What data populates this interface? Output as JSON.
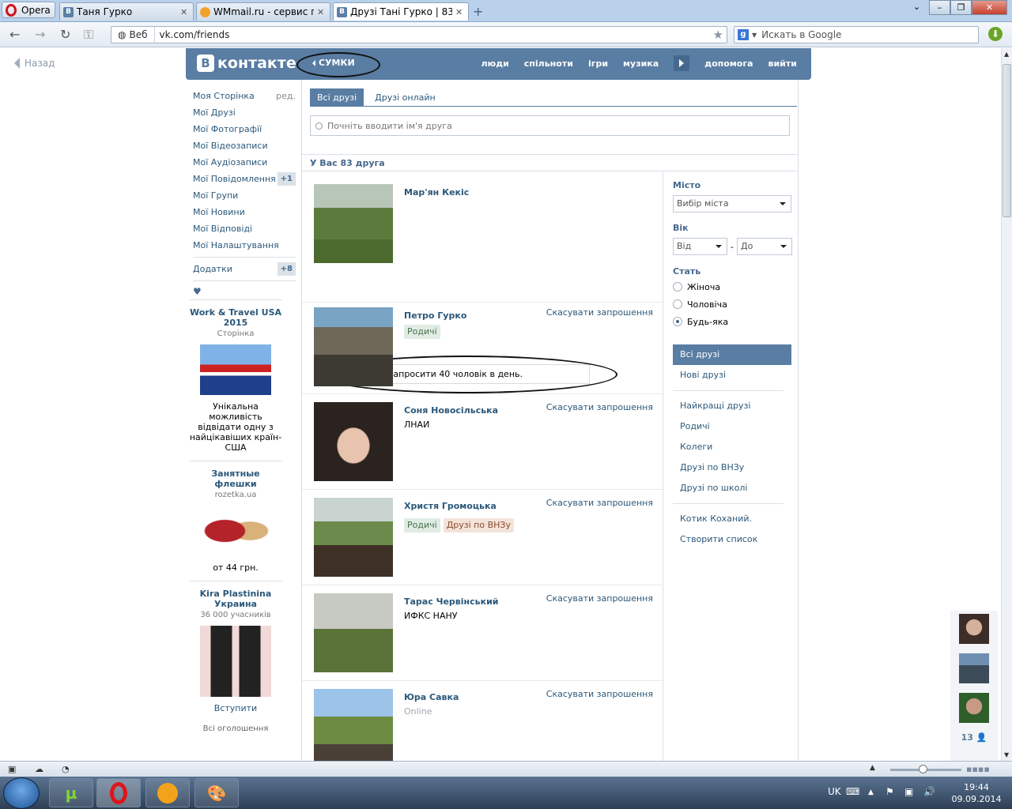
{
  "browser": {
    "menu_label": "Opera",
    "tabs": [
      {
        "title": "Таня Гурко",
        "icon": "vk-icon"
      },
      {
        "title": "WMmail.ru - сервис п...",
        "icon": "wmmail-icon"
      },
      {
        "title": "Друзі Тані Гурко | 83 д...",
        "icon": "vk-icon",
        "active": true
      }
    ],
    "web_label": "Веб",
    "url": "vk.com/friends",
    "search_placeholder": "Искать в Google",
    "back_label": "Назад"
  },
  "vk": {
    "logo_text": "контакте",
    "logo_letter": "В",
    "ad_link": "СУМКИ",
    "nav": [
      "люди",
      "спільноти",
      "ігри",
      "музика",
      "допомога",
      "вийти"
    ],
    "left_menu": [
      {
        "label": "Моя Сторінка",
        "extra": "ред."
      },
      {
        "label": "Мої Друзі"
      },
      {
        "label": "Мої Фотографії"
      },
      {
        "label": "Мої Відеозаписи"
      },
      {
        "label": "Мої Аудіозаписи"
      },
      {
        "label": "Мої Повідомлення",
        "badge": "+1"
      },
      {
        "label": "Мої Групи"
      },
      {
        "label": "Мої Новини"
      },
      {
        "label": "Мої Відповіді"
      },
      {
        "label": "Мої Налаштування"
      }
    ],
    "apps": {
      "label": "Додатки",
      "badge": "+8"
    },
    "heart": "♥",
    "ads": [
      {
        "title": "Work & Travel USA 2015",
        "sub": "Сторінка",
        "desc": "Унікальна можливість відвідати одну з найцікавіших країн-США"
      },
      {
        "title": "Занятные флешки",
        "sub": "rozetka.ua",
        "desc": "от 44 грн."
      },
      {
        "title": "Kira Plastinina Украина",
        "sub": "36 000 учасників",
        "link": "Вступити"
      }
    ],
    "all_ads": "Всі оголошення",
    "tabs": [
      "Всі друзі",
      "Друзі онлайн"
    ],
    "search_placeholder": "Почніть вводити ім'я друга",
    "count_text": "У Вас 83 друга",
    "invite_notice": "Ви можете запросити 40 чоловік в день.",
    "cancel_label": "Скасувати запрошення",
    "friends": [
      {
        "name": "Мар'ян Кекіс",
        "sub": "",
        "tags": []
      },
      {
        "name": "Петро Гурко",
        "sub": "",
        "tags": [
          "Родичі"
        ]
      },
      {
        "name": "Соня Новосільська",
        "sub": "ЛНАИ",
        "tags": []
      },
      {
        "name": "Христя Громоцька",
        "sub": "",
        "tags": [
          "Родичі",
          "Друзі по ВНЗу"
        ]
      },
      {
        "name": "Тарас Червінський",
        "sub": "ИФКС НАНУ",
        "tags": []
      },
      {
        "name": "Юра Савка",
        "sub": "Online",
        "tags": []
      }
    ],
    "filter": {
      "city_label": "Місто",
      "city_value": "Вибір міста",
      "age_label": "Вік",
      "age_from": "Від",
      "age_dash": "-",
      "age_to": "До",
      "gender_label": "Стать",
      "genders": [
        "Жіноча",
        "Чоловіча",
        "Будь-яка"
      ],
      "gender_selected": "Будь-яка",
      "menu": [
        "Всі друзі",
        "Нові друзі",
        "Найкращі друзі",
        "Родичі",
        "Колеги",
        "Друзі по ВНЗу",
        "Друзі по школі",
        "Котик Коханий.",
        "Створити список"
      ]
    },
    "dock_count": "13"
  },
  "taskbar": {
    "lang": "UK",
    "time": "19:44",
    "date": "09.09.2014"
  }
}
